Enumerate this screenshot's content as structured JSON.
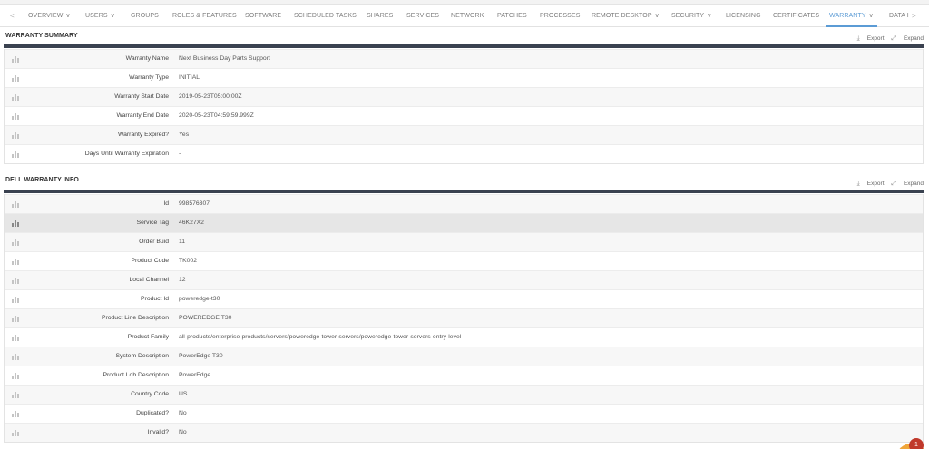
{
  "tabs": {
    "prev": "<",
    "next": ">",
    "items": [
      {
        "label": "OVERVIEW",
        "dropdown": true
      },
      {
        "label": "USERS",
        "dropdown": true
      },
      {
        "label": "GROUPS",
        "dropdown": false
      },
      {
        "label": "ROLES & FEATURES",
        "dropdown": false
      },
      {
        "label": "SOFTWARE",
        "dropdown": false
      },
      {
        "label": "SCHEDULED TASKS",
        "dropdown": false
      },
      {
        "label": "SHARES",
        "dropdown": false
      },
      {
        "label": "SERVICES",
        "dropdown": false
      },
      {
        "label": "NETWORK",
        "dropdown": false
      },
      {
        "label": "PATCHES",
        "dropdown": false
      },
      {
        "label": "PROCESSES",
        "dropdown": false
      },
      {
        "label": "REMOTE DESKTOP",
        "dropdown": true
      },
      {
        "label": "SECURITY",
        "dropdown": true
      },
      {
        "label": "LICENSING",
        "dropdown": false
      },
      {
        "label": "CERTIFICATES",
        "dropdown": false
      },
      {
        "label": "WARRANTY",
        "dropdown": true,
        "active": true
      },
      {
        "label": "DATA I",
        "dropdown": false
      }
    ]
  },
  "warranty_summary": {
    "title": "WARRANTY SUMMARY",
    "export_label": "Export",
    "expand_label": "Expand",
    "rows": [
      {
        "label": "Warranty Name",
        "value": "Next Business Day Parts Support"
      },
      {
        "label": "Warranty Type",
        "value": "INITIAL"
      },
      {
        "label": "Warranty Start Date",
        "value": "2019-05-23T05:00:00Z"
      },
      {
        "label": "Warranty End Date",
        "value": "2020-05-23T04:59:59.999Z"
      },
      {
        "label": "Warranty Expired?",
        "value": "Yes"
      },
      {
        "label": "Days Until Warranty Expiration",
        "value": "-"
      }
    ]
  },
  "dell_warranty_info": {
    "title": "DELL WARRANTY INFO",
    "export_label": "Export",
    "expand_label": "Expand",
    "rows": [
      {
        "label": "Id",
        "value": "998576307"
      },
      {
        "label": "Service Tag",
        "value": "46K27X2",
        "highlighted": true
      },
      {
        "label": "Order Buid",
        "value": "11"
      },
      {
        "label": "Product Code",
        "value": "TK002"
      },
      {
        "label": "Local Channel",
        "value": "12"
      },
      {
        "label": "Product Id",
        "value": "poweredge-t30"
      },
      {
        "label": "Product Line Description",
        "value": "POWEREDGE T30"
      },
      {
        "label": "Product Family",
        "value": "all-products/enterprise-products/servers/poweredge-tower-servers/poweredge-tower-servers-entry-level"
      },
      {
        "label": "System Description",
        "value": "PowerEdge T30"
      },
      {
        "label": "Product Lob Description",
        "value": "PowerEdge"
      },
      {
        "label": "Country Code",
        "value": "US"
      },
      {
        "label": "Duplicated?",
        "value": "No"
      },
      {
        "label": "Invalid?",
        "value": "No"
      }
    ]
  },
  "notification": {
    "count": "1"
  },
  "colors": {
    "accent": "#5b9bd5",
    "rule": "#3a4250",
    "badge": "#c0392b"
  }
}
